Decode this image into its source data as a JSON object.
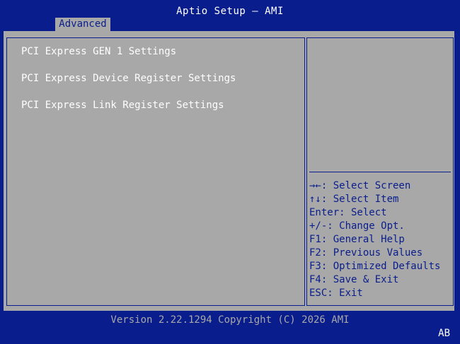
{
  "header": {
    "title": "Aptio Setup – AMI",
    "tabs": [
      {
        "label": "Advanced"
      }
    ]
  },
  "menu": {
    "items": [
      {
        "label": "PCI Express GEN 1 Settings"
      },
      {
        "label": "PCI Express Device Register Settings"
      },
      {
        "label": "PCI Express Link Register Settings"
      }
    ]
  },
  "help": {
    "text": "",
    "keys": [
      "→←: Select Screen",
      "↑↓: Select Item",
      "Enter: Select",
      "+/-: Change Opt.",
      "F1: General Help",
      "F2: Previous Values",
      "F3: Optimized Defaults",
      "F4: Save & Exit",
      "ESC: Exit"
    ]
  },
  "footer": {
    "version": "Version 2.22.1294 Copyright (C) 2026 AMI",
    "corner": "AB"
  },
  "colors": {
    "background": "#0a1d8c",
    "panel": "#a8a8a8",
    "text_white": "#ffffff",
    "text_blue": "#0a1d8c"
  }
}
